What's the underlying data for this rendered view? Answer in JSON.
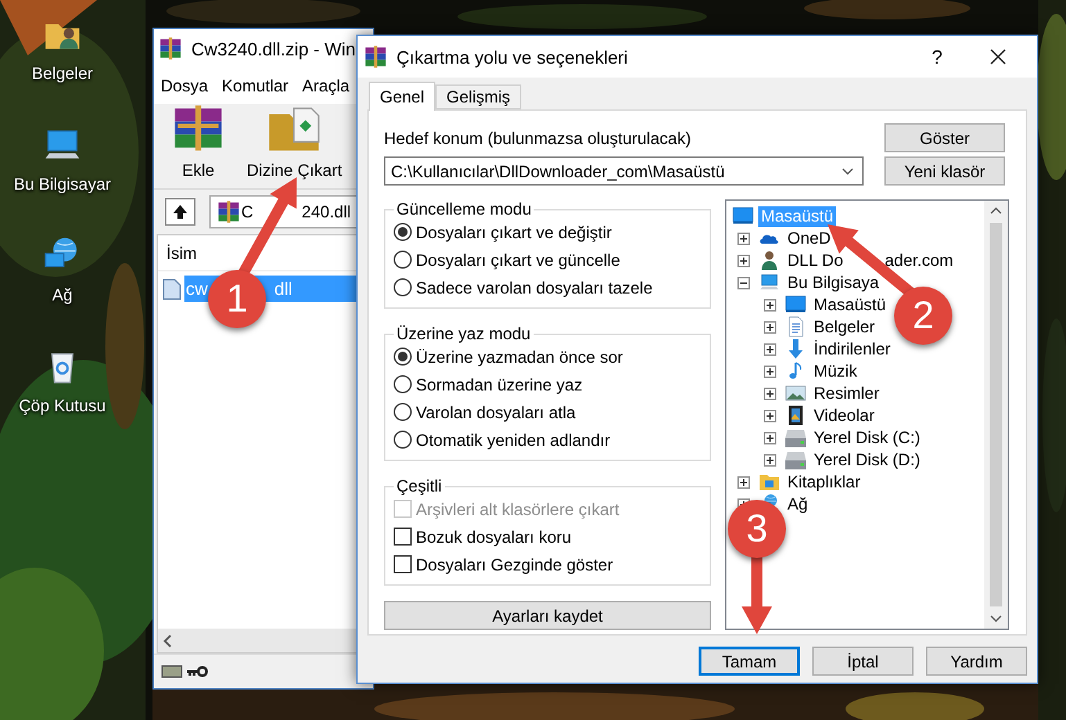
{
  "desktop_icons": [
    {
      "label": "Belgeler",
      "kind": "folder"
    },
    {
      "label": "Bu Bilgisayar",
      "kind": "computer"
    },
    {
      "label": "Ağ",
      "kind": "network"
    },
    {
      "label": "Çöp Kutusu",
      "kind": "bin"
    }
  ],
  "winrar": {
    "title": "Cw3240.dll.zip - Win",
    "menu": [
      "Dosya",
      "Komutlar",
      "Araçla"
    ],
    "toolbar": [
      {
        "label": "Ekle",
        "kind": "add"
      },
      {
        "label": "Dizine Çıkart",
        "kind": "extract"
      }
    ],
    "address": {
      "text": "C",
      "rest": "240.dll"
    },
    "columns": [
      "İsim"
    ],
    "rows": [
      {
        "text": "cw",
        "rest": "dll",
        "selected": true
      }
    ]
  },
  "dialog": {
    "title": "Çıkartma yolu ve seçenekleri",
    "help": "?",
    "tabs": [
      {
        "label": "Genel",
        "selected": true
      },
      {
        "label": "Gelişmiş",
        "selected": false
      }
    ],
    "destination": {
      "label": "Hedef konum (bulunmazsa oluşturulacak)",
      "value": "C:\\Kullanıcılar\\DllDownloader_com\\Masaüstü"
    },
    "side_buttons": [
      "Göster",
      "Yeni klasör"
    ],
    "groups": [
      {
        "title": "Güncelleme modu",
        "kind": "radio",
        "options": [
          {
            "label": "Dosyaları çıkart ve değiştir",
            "selected": true
          },
          {
            "label": "Dosyaları çıkart ve güncelle",
            "selected": false
          },
          {
            "label": "Sadece varolan dosyaları tazele",
            "selected": false
          }
        ]
      },
      {
        "title": "Üzerine yaz modu",
        "kind": "radio",
        "options": [
          {
            "label": "Üzerine yazmadan önce sor",
            "selected": true
          },
          {
            "label": "Sormadan üzerine yaz",
            "selected": false
          },
          {
            "label": "Varolan dosyaları atla",
            "selected": false
          },
          {
            "label": "Otomatik yeniden adlandır",
            "selected": false
          }
        ]
      },
      {
        "title": "Çeşitli",
        "kind": "checkbox",
        "options": [
          {
            "label": "Arşivleri alt klasörlere çıkart",
            "checked": false,
            "disabled": true
          },
          {
            "label": "Bozuk dosyaları koru",
            "checked": false,
            "disabled": false
          },
          {
            "label": "Dosyaları Gezginde göster",
            "checked": false,
            "disabled": false
          }
        ]
      }
    ],
    "save_button": "Ayarları kaydet",
    "tree": [
      {
        "label": "Masaüstü",
        "kind": "desktop",
        "selected": true,
        "children": [
          {
            "label": "OneD",
            "kind": "cloud",
            "selected": false,
            "expanded": false
          },
          {
            "label": "DLL Do",
            "rest": "ader.com",
            "kind": "user",
            "selected": false,
            "expanded": false
          },
          {
            "label": "Bu Bilgisaya",
            "kind": "computer",
            "selected": false,
            "expanded": true,
            "children": [
              {
                "label": "Masaüstü",
                "kind": "desktop",
                "selected": false,
                "expanded": false
              },
              {
                "label": "Belgeler",
                "kind": "documents",
                "selected": false,
                "expanded": false
              },
              {
                "label": "İndirilenler",
                "kind": "downloads",
                "selected": false,
                "expanded": false
              },
              {
                "label": "Müzik",
                "kind": "music",
                "selected": false,
                "expanded": false
              },
              {
                "label": "Resimler",
                "kind": "pictures",
                "selected": false,
                "expanded": false
              },
              {
                "label": "Videolar",
                "kind": "videos",
                "selected": false,
                "expanded": false
              },
              {
                "label": "Yerel Disk (C:)",
                "kind": "drive",
                "selected": false,
                "expanded": false
              },
              {
                "label": "Yerel Disk (D:)",
                "kind": "drive",
                "selected": false,
                "expanded": false
              }
            ]
          },
          {
            "label": "Kitaplıklar",
            "kind": "library",
            "selected": false,
            "expanded": false
          },
          {
            "label": "Ağ",
            "kind": "network",
            "selected": false,
            "expanded": false
          }
        ]
      }
    ],
    "buttons": [
      {
        "label": "Tamam",
        "focused": true
      },
      {
        "label": "İptal",
        "focused": false
      },
      {
        "label": "Yardım",
        "focused": false
      }
    ]
  },
  "annotations": [
    {
      "label": "1"
    },
    {
      "label": "2"
    },
    {
      "label": "3"
    }
  ]
}
